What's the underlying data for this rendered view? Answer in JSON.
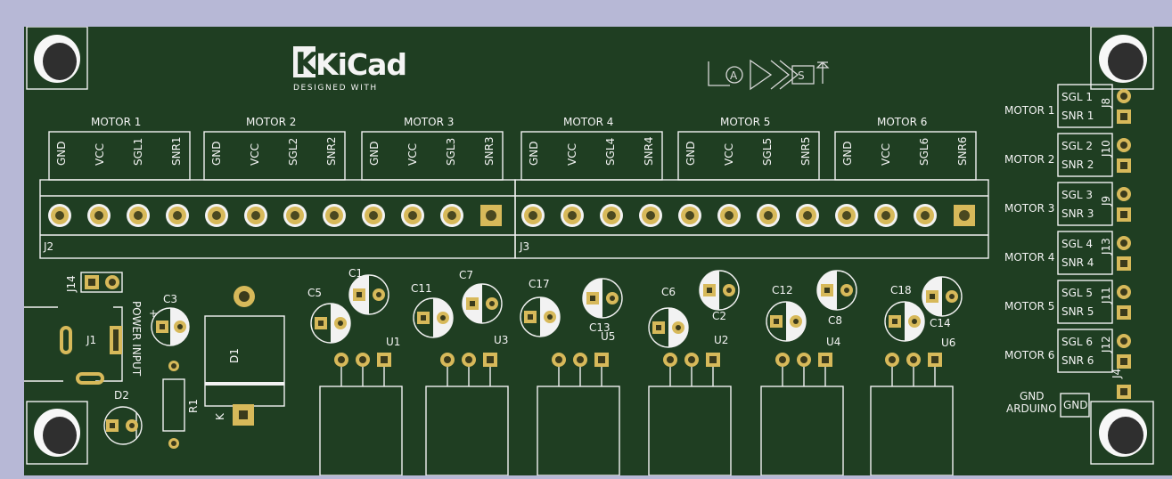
{
  "logo": {
    "brand": "KiCad",
    "tagline": "DESIGNED WITH"
  },
  "motor_labels": [
    "MOTOR 1",
    "MOTOR 2",
    "MOTOR 3",
    "MOTOR 4",
    "MOTOR 5",
    "MOTOR 6"
  ],
  "pin_labels": [
    [
      "GND",
      "VCC",
      "SGL1",
      "SNR1"
    ],
    [
      "GND",
      "VCC",
      "SGL2",
      "SNR2"
    ],
    [
      "GND",
      "VCC",
      "SGL3",
      "SNR3"
    ],
    [
      "GND",
      "VCC",
      "SGL4",
      "SNR4"
    ],
    [
      "GND",
      "VCC",
      "SGL5",
      "SNR5"
    ],
    [
      "GND",
      "VCC",
      "SGL6",
      "SNR6"
    ]
  ],
  "connectors": {
    "j2": "J2",
    "j3": "J3"
  },
  "right_headers": [
    {
      "motor": "MOTOR 1",
      "sgl": "SGL 1",
      "snr": "SNR 1",
      "ref": "J8"
    },
    {
      "motor": "MOTOR 2",
      "sgl": "SGL 2",
      "snr": "SNR 2",
      "ref": "J10"
    },
    {
      "motor": "MOTOR 3",
      "sgl": "SGL 3",
      "snr": "SNR 3",
      "ref": "J9"
    },
    {
      "motor": "MOTOR 4",
      "sgl": "SGL 4",
      "snr": "SNR 4",
      "ref": "J13"
    },
    {
      "motor": "MOTOR 5",
      "sgl": "SGL 5",
      "snr": "SNR 5",
      "ref": "J11"
    },
    {
      "motor": "MOTOR 6",
      "sgl": "SGL 6",
      "snr": "SNR 6",
      "ref": "J12"
    }
  ],
  "gnd_header": {
    "label_top": "GND",
    "label_bottom": "ARDUINO",
    "pin": "GND",
    "ref": "J4"
  },
  "power": {
    "j14": "J14",
    "j1": "J1",
    "power_input": "POWER INPUT",
    "c3": "C3",
    "d1": "D1",
    "k": "K",
    "d2": "D2",
    "r1": "R1"
  },
  "capacitors": [
    "C5",
    "C1",
    "C11",
    "C7",
    "C17",
    "C13",
    "C6",
    "C2",
    "C12",
    "C8",
    "C18",
    "C14"
  ],
  "regulators": [
    "U1",
    "U3",
    "U5",
    "U2",
    "U4",
    "U6"
  ]
}
